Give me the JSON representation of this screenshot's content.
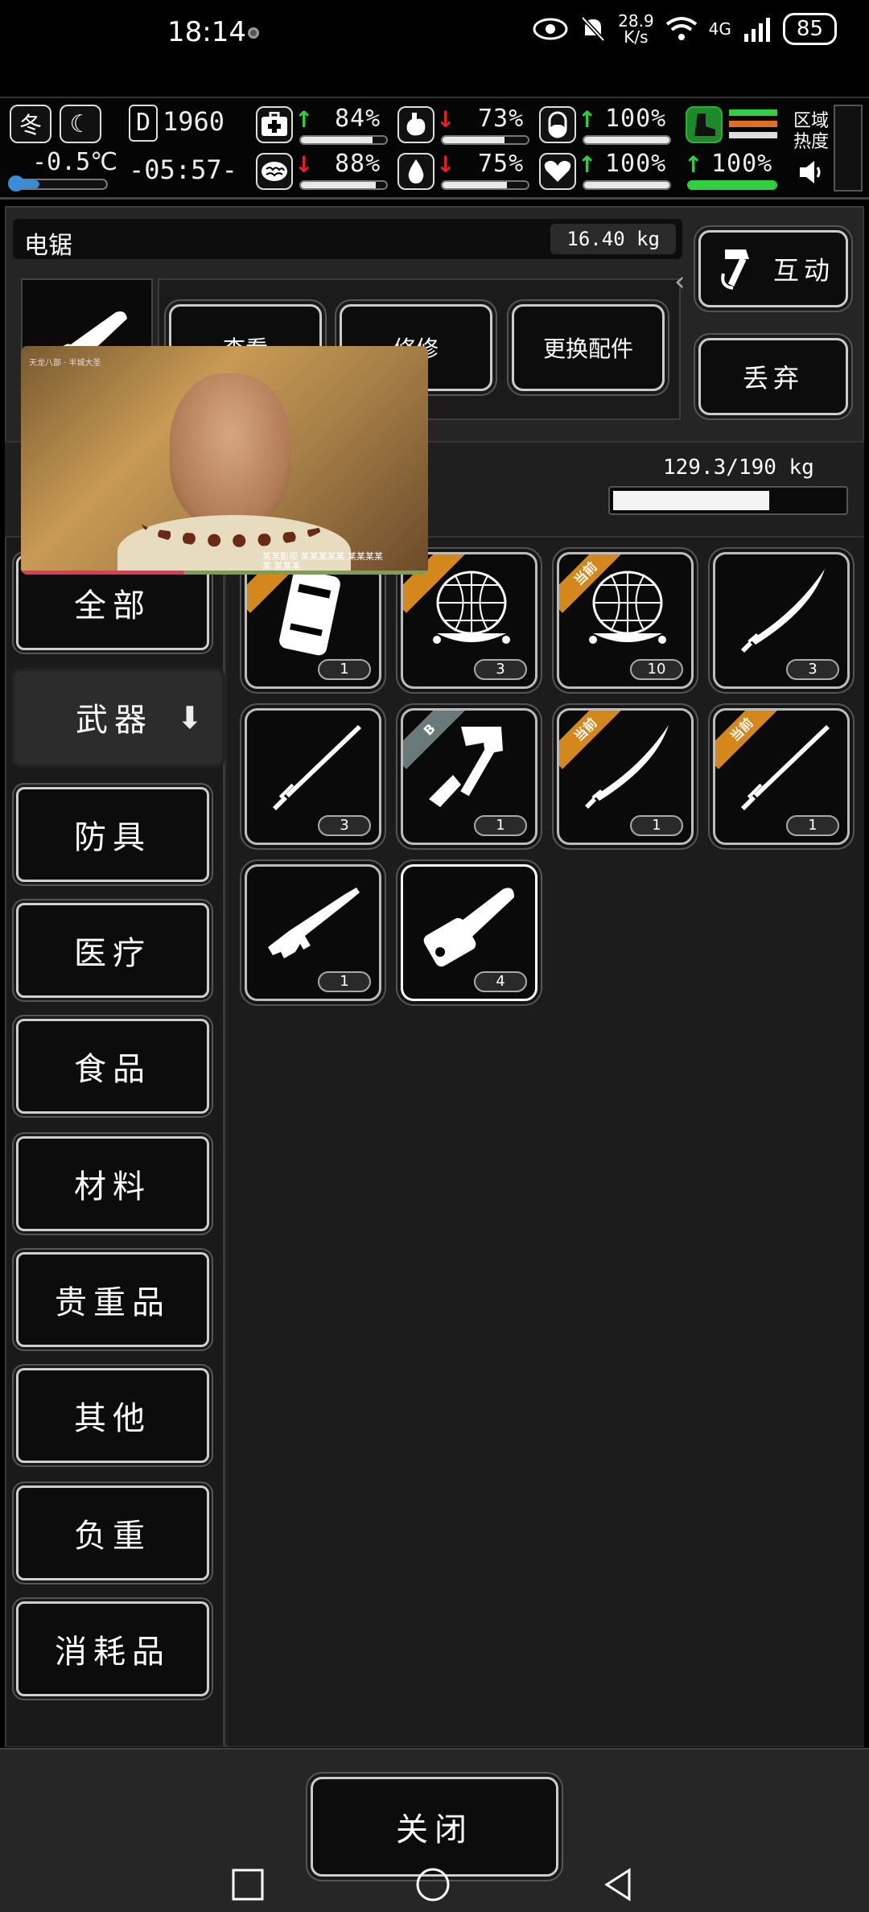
{
  "status_bar": {
    "time": "18:14",
    "net_speed": "28.9",
    "net_unit": "K/s",
    "net_type": "4G",
    "battery": "85"
  },
  "hud": {
    "season": "冬",
    "temperature": "-0.5℃",
    "day_label": "D",
    "day": "1960",
    "clock": "-05:57-",
    "stats": [
      {
        "icon": "medkit-icon",
        "value": "84%",
        "trend": "up",
        "level": 0.84
      },
      {
        "icon": "stomach-icon",
        "value": "73%",
        "trend": "down",
        "level": 0.73
      },
      {
        "icon": "pill-icon",
        "value": "100%",
        "trend": "up",
        "level": 1.0
      },
      {
        "icon": "brain-icon",
        "value": "88%",
        "trend": "down",
        "level": 0.88
      },
      {
        "icon": "water-drop-icon",
        "value": "75%",
        "trend": "down",
        "level": 0.75
      },
      {
        "icon": "heart-icon",
        "value": "100%",
        "trend": "up",
        "level": 1.0
      },
      {
        "icon": "boot-icon",
        "value": "100%",
        "trend": "up",
        "level": 1.0
      }
    ],
    "zone_heat_label_1": "区域",
    "zone_heat_label_2": "热度",
    "color_up": "#32d040",
    "color_down": "#e82020"
  },
  "item": {
    "name": "电锯",
    "weight": "16.40 kg"
  },
  "actions": {
    "view_label": "查看",
    "repair_label": "修修",
    "change_parts_label": "更换配件",
    "interact_label": "互动",
    "discard_label": "丢弃"
  },
  "capacity": {
    "text": "129.3/190 kg",
    "fraction": 0.68
  },
  "categories": [
    "全部",
    "武器",
    "防具",
    "医疗",
    "食品",
    "材料",
    "贵重品",
    "其他",
    "负重",
    "消耗品"
  ],
  "active_category_index": 1,
  "inventory": [
    {
      "name": "ammo-case-icon",
      "qty": "1",
      "tag": ""
    },
    {
      "name": "net-trap-icon",
      "qty": "3",
      "tag": ""
    },
    {
      "name": "net-trap-icon",
      "qty": "10",
      "tag": "当前"
    },
    {
      "name": "katana-icon",
      "qty": "3",
      "tag": ""
    },
    {
      "name": "sword-icon",
      "qty": "3",
      "tag": ""
    },
    {
      "name": "axe-icon",
      "qty": "1",
      "tag": "B"
    },
    {
      "name": "katana-icon",
      "qty": "1",
      "tag": "当前"
    },
    {
      "name": "sword-icon",
      "qty": "1",
      "tag": "当前"
    },
    {
      "name": "rifle-icon",
      "qty": "1",
      "tag": ""
    },
    {
      "name": "chainsaw-icon",
      "qty": "4",
      "tag": ""
    }
  ],
  "video": {
    "watermark": "天龙八部 · 半城大圣",
    "subtitle": "某某影视 某某某某某 某某某某某 某某某"
  },
  "close_label": "关闭"
}
